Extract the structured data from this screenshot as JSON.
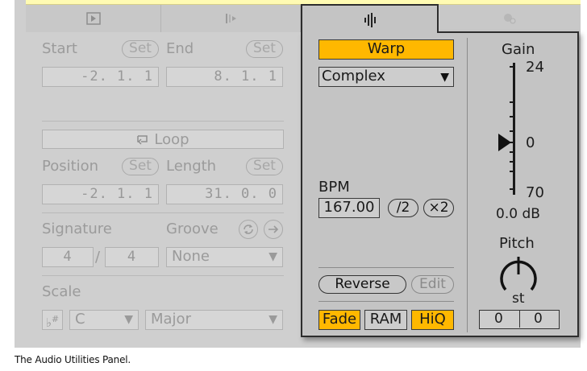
{
  "tabs": {
    "tab1_icon": "play-box-icon",
    "tab2_icon": "marker-icon",
    "tab3_icon": "waveform-icon",
    "tab4_icon": "mixer-icon"
  },
  "clip": {
    "start_label": "Start",
    "end_label": "End",
    "set_label": "Set",
    "start_value": "-2. 1. 1",
    "end_value": "8. 1. 1",
    "loop_label": "Loop",
    "position_label": "Position",
    "length_label": "Length",
    "position_value": "-2. 1. 1",
    "length_value": "31. 0. 0",
    "signature_label": "Signature",
    "groove_label": "Groove",
    "sig_numerator": "4",
    "sig_slash": "/",
    "sig_denominator": "4",
    "groove_value": "None",
    "scale_label": "Scale",
    "scale_icon": "flat-sharp-icon",
    "scale_root": "C",
    "scale_mode": "Major"
  },
  "audio": {
    "warp_label": "Warp",
    "warp_mode": "Complex",
    "bpm_label": "BPM",
    "bpm_value": "167.00",
    "half_label": "/2",
    "double_label": "×2",
    "reverse_label": "Reverse",
    "edit_label": "Edit",
    "fade_label": "Fade",
    "ram_label": "RAM",
    "hiq_label": "HiQ",
    "gain_label": "Gain",
    "gain_top": "24",
    "gain_mid": "0",
    "gain_bottom": "70",
    "gain_value": "0.0 dB",
    "pitch_label": "Pitch",
    "pitch_unit": "st",
    "pitch_semitones": "0",
    "pitch_cents": "0"
  },
  "caption": "The Audio Utilities Panel.",
  "colors": {
    "accent": "#ffb800",
    "panel": "#c4c4c4",
    "inactive": "#cfcfcf"
  }
}
